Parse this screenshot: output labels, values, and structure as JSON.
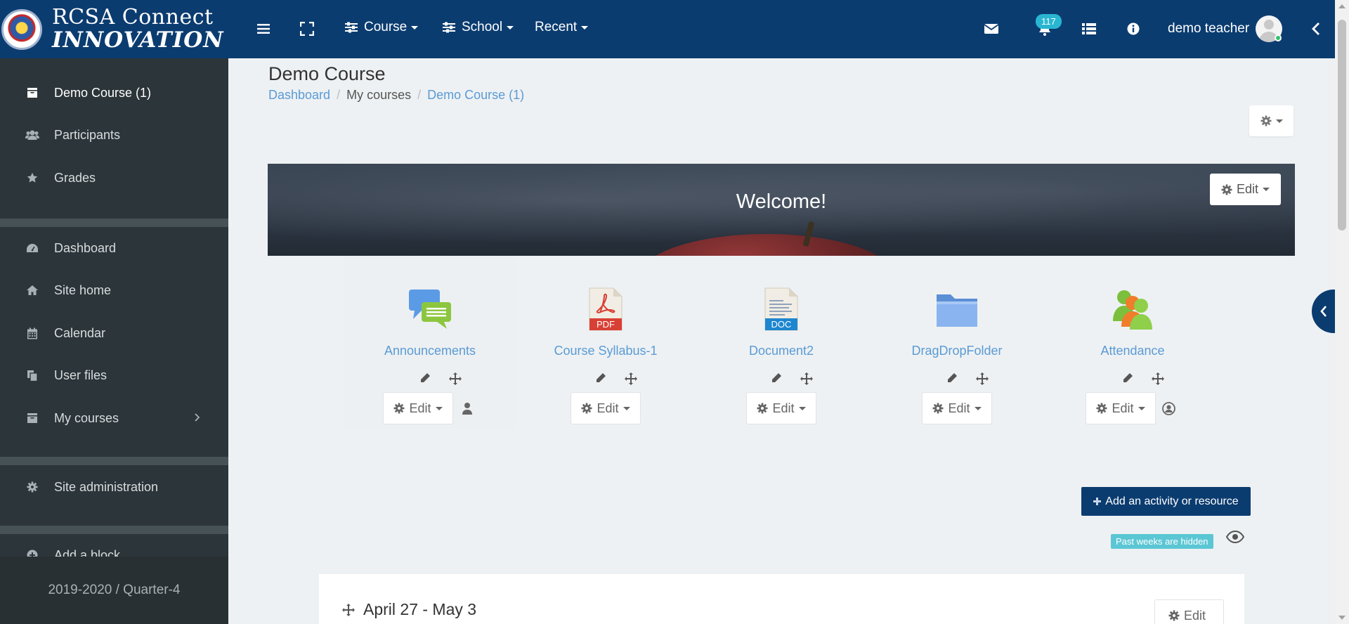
{
  "brand": {
    "line1": "RCSA Connect",
    "line2": "INNOVATION"
  },
  "navbar": {
    "menus": [
      {
        "label": "Course"
      },
      {
        "label": "School"
      },
      {
        "label": "Recent"
      }
    ],
    "notification_count": "117",
    "user_name": "demo teacher"
  },
  "sidebar": {
    "items": [
      {
        "label": "Demo Course (1)",
        "icon": "archive-icon"
      },
      {
        "label": "Participants",
        "icon": "users-icon"
      },
      {
        "label": "Grades",
        "icon": "star-icon"
      },
      {
        "label": "Dashboard",
        "icon": "dashboard-icon"
      },
      {
        "label": "Site home",
        "icon": "home-icon"
      },
      {
        "label": "Calendar",
        "icon": "calendar-icon"
      },
      {
        "label": "User files",
        "icon": "files-icon"
      },
      {
        "label": "My courses",
        "icon": "archive-icon"
      },
      {
        "label": "Site administration",
        "icon": "gear-icon"
      },
      {
        "label": "Add a block",
        "icon": "plus-circle-icon"
      }
    ],
    "footer": "2019-2020 / Quarter-4"
  },
  "page": {
    "title": "Demo Course",
    "breadcrumb": [
      "Dashboard",
      "My courses",
      "Demo Course (1)"
    ]
  },
  "banner": {
    "title": "Welcome!",
    "edit_label": "Edit"
  },
  "activities": [
    {
      "name": "Announcements",
      "edit_label": "Edit",
      "icon": "forum-icon"
    },
    {
      "name": "Course Syllabus-1",
      "edit_label": "Edit",
      "icon": "pdf-icon",
      "badge": "PDF"
    },
    {
      "name": "Document2",
      "edit_label": "Edit",
      "icon": "doc-icon",
      "badge": "DOC"
    },
    {
      "name": "DragDropFolder",
      "edit_label": "Edit",
      "icon": "folder-icon"
    },
    {
      "name": "Attendance",
      "edit_label": "Edit",
      "icon": "attendance-icon"
    }
  ],
  "actions": {
    "add_activity": "Add an activity or resource",
    "past_weeks": "Past weeks are hidden"
  },
  "section": {
    "title": "April 27 - May 3",
    "edit_label": "Edit"
  },
  "colors": {
    "navbar": "#0b3c70",
    "sidebar": "#2c3539",
    "link": "#5a9bd5",
    "badge": "#29b6d1"
  }
}
